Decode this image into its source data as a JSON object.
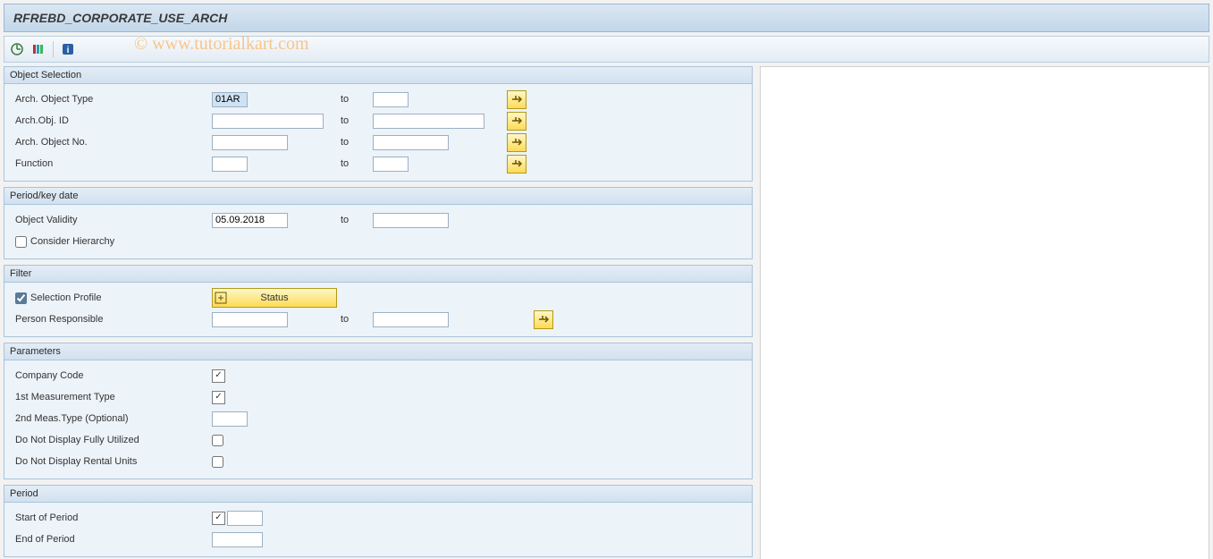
{
  "title": "RFREBD_CORPORATE_USE_ARCH",
  "watermark": "© www.tutorialkart.com",
  "groups": {
    "objectSelection": {
      "title": "Object Selection",
      "rows": {
        "archObjType": {
          "label": "Arch. Object Type",
          "from": "01AR",
          "to_label": "to",
          "to": ""
        },
        "archObjId": {
          "label": "Arch.Obj. ID",
          "from": "",
          "to_label": "to",
          "to": ""
        },
        "archObjNo": {
          "label": "Arch. Object No.",
          "from": "",
          "to_label": "to",
          "to": ""
        },
        "function": {
          "label": "Function",
          "from": "",
          "to_label": "to",
          "to": ""
        }
      }
    },
    "periodKey": {
      "title": "Period/key date",
      "rows": {
        "objectValidity": {
          "label": "Object Validity",
          "from": "05.09.2018",
          "to_label": "to",
          "to": ""
        },
        "considerHierarchy": {
          "label": "Consider Hierarchy",
          "checked": false
        }
      }
    },
    "filter": {
      "title": "Filter",
      "rows": {
        "selectionProfile": {
          "label": "Selection Profile",
          "checked": true,
          "status_label": "Status"
        },
        "personResponsible": {
          "label": "Person Responsible",
          "from": "",
          "to_label": "to",
          "to": ""
        }
      }
    },
    "parameters": {
      "title": "Parameters",
      "rows": {
        "companyCode": {
          "label": "Company Code"
        },
        "firstMeasType": {
          "label": "1st Measurement Type"
        },
        "secondMeasType": {
          "label": "2nd Meas.Type (Optional)",
          "value": ""
        },
        "noFullyUtilized": {
          "label": "Do Not Display Fully Utilized",
          "checked": false
        },
        "noRentalUnits": {
          "label": "Do Not Display Rental Units",
          "checked": false
        }
      }
    },
    "period": {
      "title": "Period",
      "rows": {
        "startPeriod": {
          "label": "Start of Period"
        },
        "endPeriod": {
          "label": "End of Period",
          "value": ""
        }
      }
    }
  }
}
